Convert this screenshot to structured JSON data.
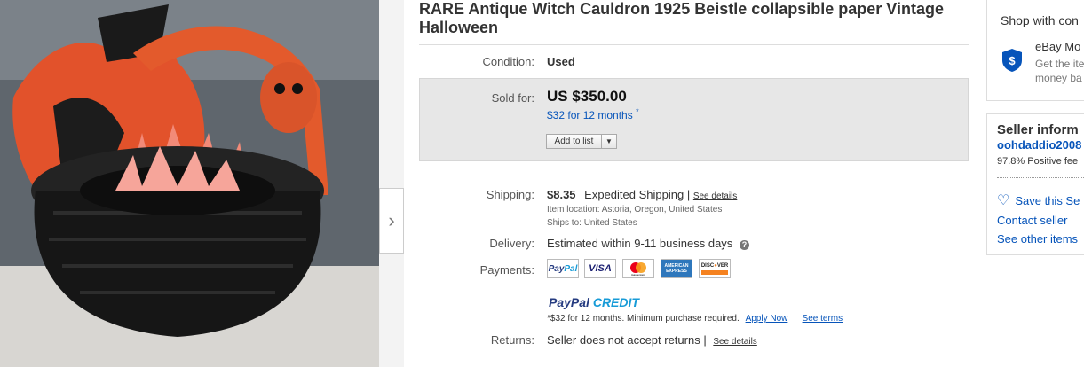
{
  "gallery": {
    "image_alt": "Antique witch cauldron Halloween paper decoration",
    "next_icon": "chevron-right-icon"
  },
  "listing": {
    "title": "RARE Antique Witch Cauldron 1925 Beistle collapsible paper Vintage Halloween",
    "condition_label": "Condition:",
    "condition_value": "Used",
    "sold_for_label": "Sold for:",
    "price": "US $350.00",
    "credit_offer": "$32 for 12 months",
    "credit_star": "*",
    "add_to_list": "Add to list",
    "shipping_label": "Shipping:",
    "shipping_cost": "$8.35",
    "shipping_method": "Expedited Shipping |",
    "see_details": "See details",
    "item_location": "Item location:  Astoria, Oregon, United States",
    "ships_to": "Ships to:  United States",
    "delivery_label": "Delivery:",
    "delivery_value": "Estimated within 9-11 business days",
    "help_icon": "question-icon",
    "payments_label": "Payments:",
    "payment_methods": [
      "PayPal",
      "VISA",
      "mastercard",
      "AMERICAN EXPRESS",
      "DISCOVER"
    ],
    "paypal_credit_1": "PayPal",
    "paypal_credit_2": "CREDIT",
    "credit_terms": "*$32 for 12 months. Minimum purchase required.",
    "apply_now": "Apply Now",
    "see_terms": "See terms",
    "returns_label": "Returns:",
    "returns_value": "Seller does not accept returns |",
    "returns_details": "See details"
  },
  "sidebar": {
    "shop_header": "Shop with con",
    "guarantee_title": "eBay Mo",
    "guarantee_line1": "Get the ite",
    "guarantee_line2": "money ba",
    "guarantee_icon": "dollar-shield-icon",
    "seller_header": "Seller inform",
    "seller_name": "oohdaddio2008",
    "feedback": "97.8% Positive fee",
    "save_seller": "Save this Se",
    "heart_icon": "heart-icon",
    "contact_seller": "Contact seller",
    "see_other_items": "See other items"
  },
  "colors": {
    "link": "#0654ba",
    "paypal_dark": "#253b80",
    "paypal_light": "#179bd7",
    "sold_box_bg": "#e7e7e7"
  }
}
